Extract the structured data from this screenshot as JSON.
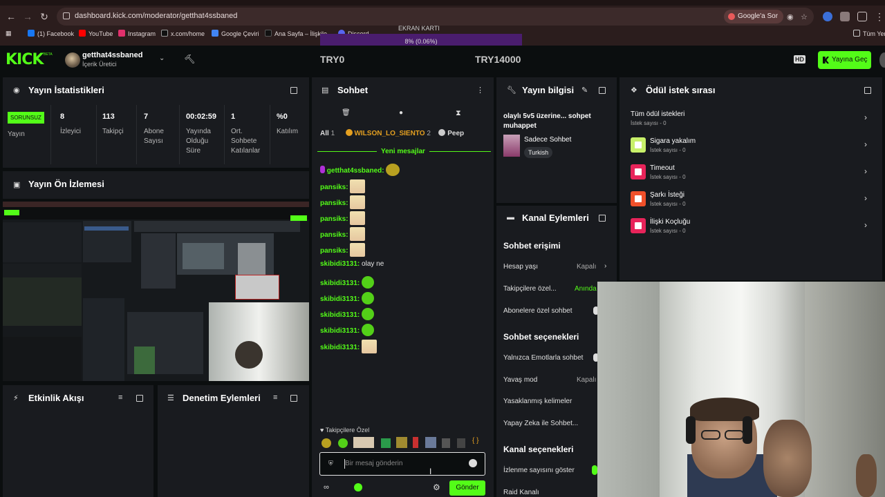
{
  "browser": {
    "url": "dashboard.kick.com/moderator/getthat4ssbaned",
    "google_search_label": "Google'a Sor",
    "bookmarks": [
      {
        "label": "(1) Facebook",
        "color": "#1877f2"
      },
      {
        "label": "YouTube",
        "color": "#ff0000"
      },
      {
        "label": "Instagram",
        "color": "#e1306c"
      },
      {
        "label": "x.com/home",
        "color": "#000000"
      },
      {
        "label": "Google Çeviri",
        "color": "#4285f4"
      },
      {
        "label": "Ana Sayfa – İlişkile...",
        "color": "#111111"
      },
      {
        "label": "Discord",
        "color": "#5865f2"
      }
    ],
    "bookmarks_right": "Tüm Yer"
  },
  "gpu_overlay": {
    "title": "EKRAN KARTI",
    "value": "8% (0.06%)"
  },
  "header": {
    "logo": "KICK",
    "logo_badge": "BETA",
    "channel_name": "getthat4ssbaned",
    "channel_role": "İçerik Üretici",
    "goal_left": "TRY0",
    "goal_right": "TRY14000",
    "hd_label": "HD",
    "go_live_label": "Yayına Geç"
  },
  "stats_panel": {
    "title": "Yayın İstatistikleri",
    "status_badge": "SORUNSUZ",
    "status_label": "Yayın",
    "items": [
      {
        "value": "8",
        "label": "İzleyici"
      },
      {
        "value": "113",
        "label": "Takipçi"
      },
      {
        "value": "7",
        "label": "Abone Sayısı"
      },
      {
        "value": "00:02:59",
        "label": "Yayında Olduğu Süre"
      },
      {
        "value": "1",
        "label": "Ort. Sohbete Katılanlar"
      },
      {
        "value": "%0",
        "label": "Katılım"
      }
    ]
  },
  "preview_panel": {
    "title": "Yayın Ön İzlemesi"
  },
  "activity_panel": {
    "title": "Etkinlik Akışı"
  },
  "moderation_panel": {
    "title": "Denetim Eylemleri"
  },
  "chat_panel": {
    "title": "Sohbet",
    "filter_all": "All",
    "filter_all_count": "1",
    "top_gifter": "WILSON_LO_SIENTO",
    "top_gifter_count": "2",
    "filter_cut": "Peep",
    "new_messages": "Yeni mesajlar",
    "messages": [
      {
        "user": "getthat4ssbaned",
        "text": "",
        "emote": "pepe",
        "color": "#53fc18"
      },
      {
        "user": "pansiks",
        "text": "",
        "emote": "anime"
      },
      {
        "user": "pansiks",
        "text": "",
        "emote": "anime"
      },
      {
        "user": "pansiks",
        "text": "",
        "emote": "anime"
      },
      {
        "user": "pansiks",
        "text": "",
        "emote": "anime"
      },
      {
        "user": "pansiks",
        "text": "",
        "emote": "anime"
      },
      {
        "user": "skibidi3131",
        "text": "olay ne",
        "emote": ""
      },
      {
        "user": "skibidi3131",
        "text": "",
        "emote": "kick"
      },
      {
        "user": "skibidi3131",
        "text": "",
        "emote": "kick"
      },
      {
        "user": "skibidi3131",
        "text": "",
        "emote": "kick"
      },
      {
        "user": "skibidi3131",
        "text": "",
        "emote": "kick"
      },
      {
        "user": "skibidi3131",
        "text": "",
        "emote": "anime"
      }
    ],
    "followers_only": "Takipçilere Özel",
    "input_placeholder": "Bir mesaj gönderin",
    "send_label": "Gönder"
  },
  "stream_info_panel": {
    "title": "Yayın bilgisi",
    "stream_title": "olaylı 5v5 üzerine... sohpet muhappet",
    "category": "Sadece Sohbet",
    "language_tag": "Turkish"
  },
  "channel_actions_panel": {
    "title": "Kanal Eylemleri",
    "chat_access_title": "Sohbet erişimi",
    "chat_access": [
      {
        "label": "Hesap yaşı",
        "value": "Kapalı"
      },
      {
        "label": "Takipçilere özel...",
        "value": "Anında"
      },
      {
        "label": "Abonelere özel sohbet",
        "value": ""
      }
    ],
    "chat_options_title": "Sohbet seçenekleri",
    "chat_options": [
      {
        "label": "Yalnızca Emotlarla sohbet",
        "value": ""
      },
      {
        "label": "Yavaş mod",
        "value": "Kapalı"
      },
      {
        "label": "Yasaklanmış kelimeler",
        "value": ""
      },
      {
        "label": "Yapay Zeka ile Sohbet...",
        "value": ""
      }
    ],
    "channel_options_title": "Kanal seçenekleri",
    "channel_options": [
      {
        "label": "İzlenme sayısını göster",
        "value": ""
      },
      {
        "label": "Raid Kanalı",
        "value": ""
      }
    ]
  },
  "reward_queue_panel": {
    "title": "Ödül istek sırası",
    "all_label": "Tüm ödül istekleri",
    "all_count": "İstek sayısı - 0",
    "items": [
      {
        "name": "Sigara yakalım",
        "count": "İstek sayısı - 0",
        "color": "#c8f06a"
      },
      {
        "name": "Timeout",
        "count": "İstek sayısı - 0",
        "color": "#e8245a"
      },
      {
        "name": "Şarkı İsteği",
        "count": "İstek sayısı - 0",
        "color": "#f0502a"
      },
      {
        "name": "İlişki Koçluğu",
        "count": "İstek sayısı - 0",
        "color": "#e8245a"
      }
    ]
  }
}
